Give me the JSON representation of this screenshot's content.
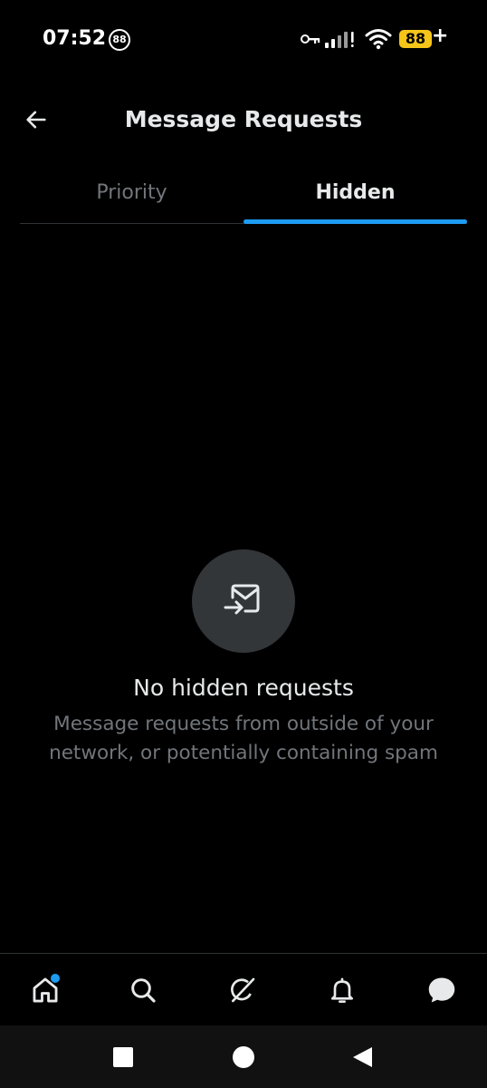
{
  "status_bar": {
    "time": "07:52",
    "notification_badge": "88",
    "battery_level": "88",
    "battery_charging": "+",
    "battery_color": "#f5c518",
    "icons": [
      "key-icon",
      "signal-icon",
      "wifi-icon",
      "battery-icon"
    ]
  },
  "header": {
    "title": "Message Requests",
    "back_icon": "arrow-left-icon"
  },
  "tabs": [
    {
      "label": "Priority",
      "active": false
    },
    {
      "label": "Hidden",
      "active": true
    }
  ],
  "accent_color": "#1d9bf0",
  "empty_state": {
    "icon": "message-request-icon",
    "title": "No hidden requests",
    "description": "Message requests from outside of your network, or potentially containing spam"
  },
  "bottom_nav": {
    "items": [
      {
        "icon": "home-icon",
        "active": true,
        "has_dot": true
      },
      {
        "icon": "search-icon",
        "active": false
      },
      {
        "icon": "grok-icon",
        "active": false
      },
      {
        "icon": "bell-icon",
        "active": false
      },
      {
        "icon": "messages-icon",
        "active": false
      }
    ]
  },
  "system_nav": {
    "items": [
      "recent-apps-icon",
      "home-circle-icon",
      "back-triangle-icon"
    ]
  }
}
